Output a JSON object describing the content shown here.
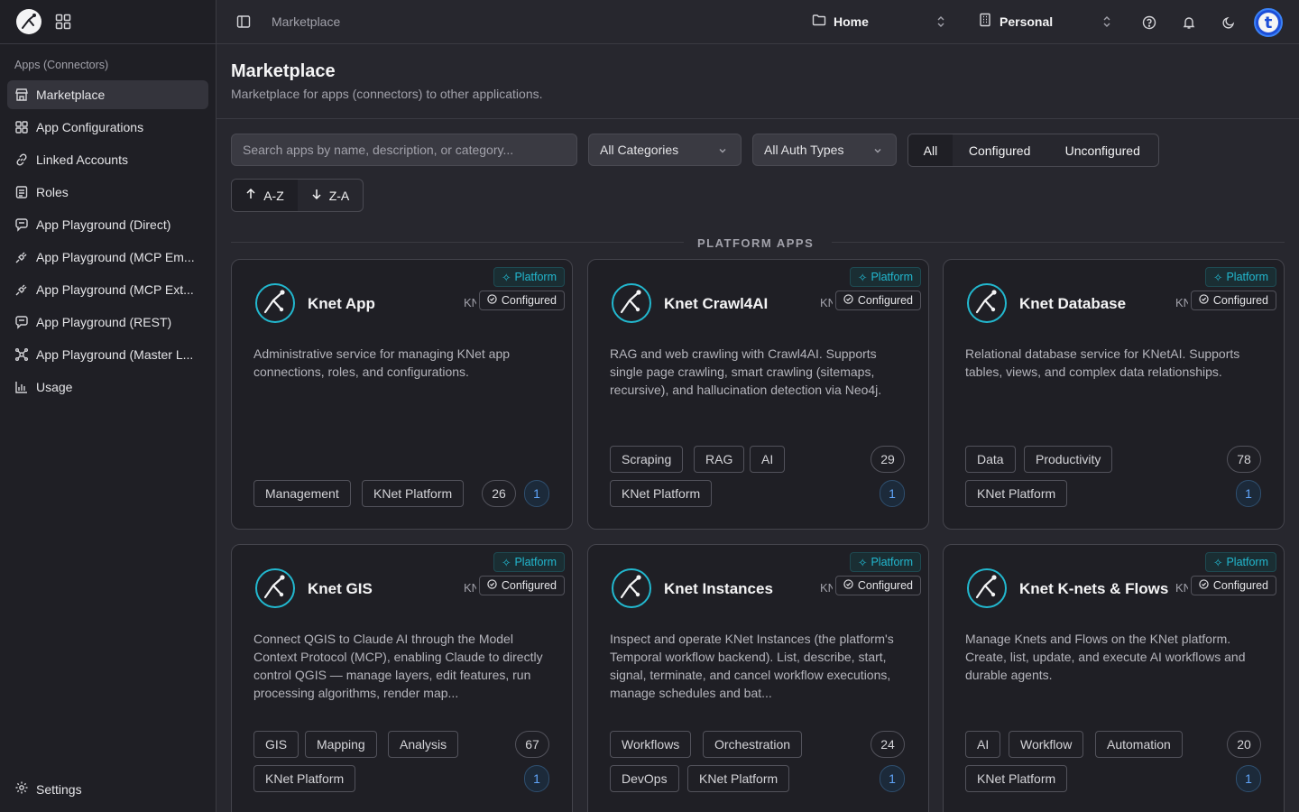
{
  "sidebar": {
    "section_label": "Apps (Connectors)",
    "items": [
      {
        "label": "Marketplace",
        "icon": "store-icon",
        "active": true
      },
      {
        "label": "App Configurations",
        "icon": "grid-icon"
      },
      {
        "label": "Linked Accounts",
        "icon": "link-icon"
      },
      {
        "label": "Roles",
        "icon": "id-card-icon"
      },
      {
        "label": "App Playground (Direct)",
        "icon": "chat-icon"
      },
      {
        "label": "App Playground (MCP Em...",
        "icon": "plug-icon"
      },
      {
        "label": "App Playground (MCP Ext...",
        "icon": "plug-icon"
      },
      {
        "label": "App Playground (REST)",
        "icon": "chat-icon"
      },
      {
        "label": "App Playground (Master L...",
        "icon": "network-icon"
      },
      {
        "label": "Usage",
        "icon": "bar-chart-icon"
      }
    ],
    "settings_label": "Settings"
  },
  "header": {
    "breadcrumb": "Marketplace",
    "workspace": "Home",
    "account": "Personal",
    "avatar_letter": "t"
  },
  "page": {
    "title": "Marketplace",
    "subtitle": "Marketplace for apps (connectors) to other applications."
  },
  "filters": {
    "search_placeholder": "Search apps by name, description, or category...",
    "category": "All Categories",
    "auth_type": "All Auth Types",
    "segments": [
      "All",
      "Configured",
      "Unconfigured"
    ],
    "active_segment": "All",
    "sort": [
      "A-Z",
      "Z-A"
    ]
  },
  "section_label": "PLATFORM APPS",
  "badges": {
    "platform": "Platform",
    "configured": "Configured",
    "kn": "KN"
  },
  "cards": [
    {
      "title": "Knet App",
      "description": "Administrative service for managing KNet app connections, roles, and configurations.",
      "tags": [
        "Management",
        "KNet Platform"
      ],
      "count": "26",
      "linked": "1"
    },
    {
      "title": "Knet Crawl4AI",
      "description": "RAG and web crawling with Crawl4AI. Supports single page crawling, smart crawling (sitemaps, recursive), and hallucination detection via Neo4j.",
      "tags": [
        "Scraping",
        "RAG",
        "AI",
        "KNet Platform"
      ],
      "count": "29",
      "linked": "1"
    },
    {
      "title": "Knet Database",
      "description": "Relational database service for KNetAI. Supports tables, views, and complex data relationships.",
      "tags": [
        "Data",
        "Productivity",
        "KNet Platform"
      ],
      "count": "78",
      "linked": "1"
    },
    {
      "title": "Knet GIS",
      "description": "Connect QGIS to Claude AI through the Model Context Protocol (MCP), enabling Claude to directly control QGIS — manage layers, edit features, run processing algorithms, render map...",
      "tags": [
        "GIS",
        "Mapping",
        "Analysis",
        "KNet Platform"
      ],
      "count": "67",
      "linked": "1"
    },
    {
      "title": "Knet Instances",
      "description": "Inspect and operate KNet Instances (the platform's Temporal workflow backend). List, describe, start, signal, terminate, and cancel workflow executions, manage schedules and bat...",
      "tags": [
        "Workflows",
        "Orchestration",
        "DevOps",
        "KNet Platform"
      ],
      "count": "24",
      "linked": "1"
    },
    {
      "title": "Knet K-nets & Flows",
      "description": "Manage Knets and Flows on the KNet platform. Create, list, update, and execute AI workflows and durable agents.",
      "tags": [
        "AI",
        "Workflow",
        "Automation",
        "KNet Platform"
      ],
      "count": "20",
      "linked": "1"
    }
  ],
  "colors": {
    "background": "#27272e",
    "sidebar": "#1f1f25",
    "card": "#1f1f25",
    "accent_cyan": "#22b8cf",
    "accent_blue": "#3b82f6"
  }
}
